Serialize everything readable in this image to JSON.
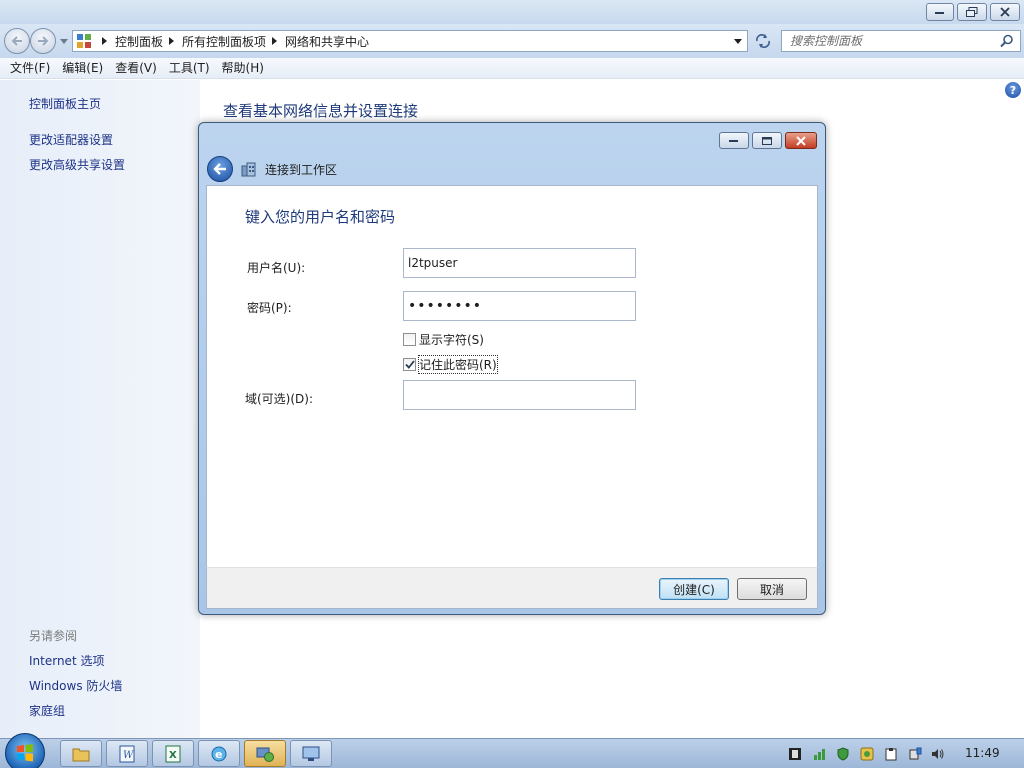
{
  "addressbar": {
    "crumbs": [
      "控制面板",
      "所有控制面板项",
      "网络和共享中心"
    ],
    "search_placeholder": "搜索控制面板"
  },
  "menu": [
    "文件(F)",
    "编辑(E)",
    "查看(V)",
    "工具(T)",
    "帮助(H)"
  ],
  "sidebar": {
    "home": "控制面板主页",
    "links": [
      "更改适配器设置",
      "更改高级共享设置"
    ],
    "see_also_label": "另请参阅",
    "see_also": [
      "Internet 选项",
      "Windows 防火墙",
      "家庭组"
    ]
  },
  "main": {
    "title": "查看基本网络信息并设置连接"
  },
  "dialog": {
    "header_title": "连接到工作区",
    "heading": "键入您的用户名和密码",
    "username_label": "用户名(U):",
    "username_value": "l2tpuser",
    "password_label": "密码(P):",
    "password_value": "password",
    "show_chars_label": "显示字符(S)",
    "show_chars_checked": false,
    "remember_label": "记住此密码(R)",
    "remember_checked": true,
    "domain_label": "域(可选)(D):",
    "domain_value": "",
    "create_label": "创建(C)",
    "cancel_label": "取消"
  },
  "taskbar": {
    "clock": "11:49",
    "apps": [
      "explorer-icon",
      "word-icon",
      "excel-icon",
      "ie-icon",
      "network-center-icon",
      "remote-desktop-icon"
    ]
  },
  "colors": {
    "link": "#1e3287",
    "heading": "#1e3a7a",
    "pane_bg": "#e7eef9"
  }
}
